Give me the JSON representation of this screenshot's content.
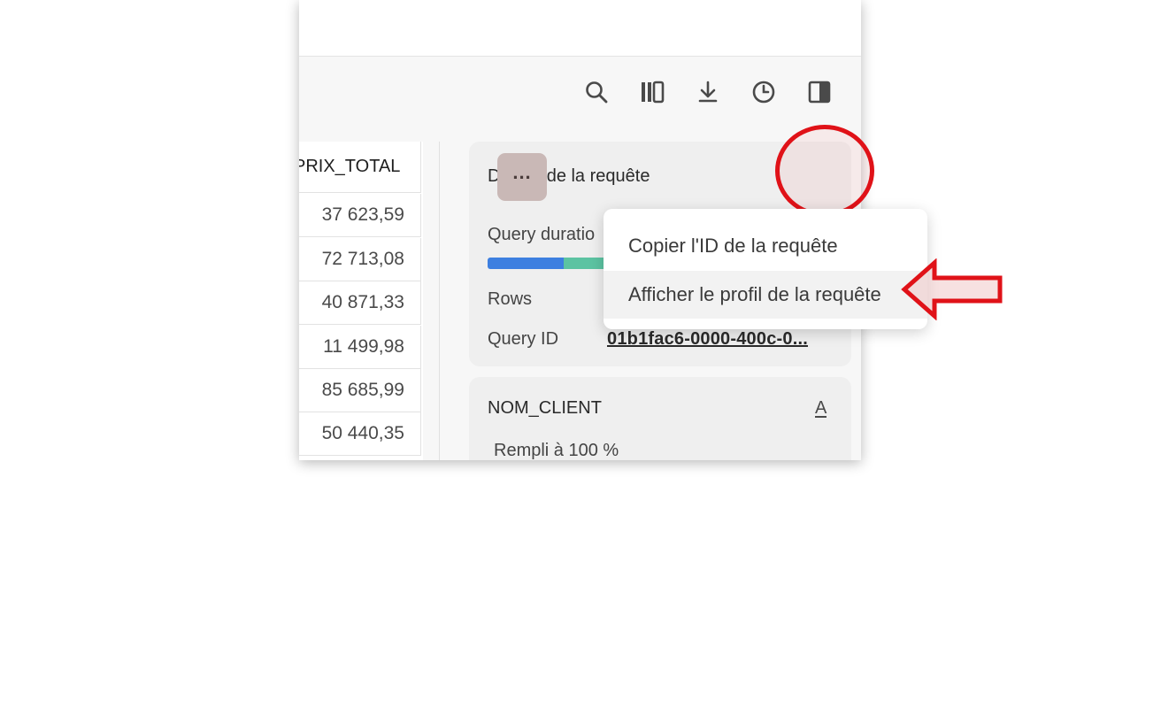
{
  "toolbar": {
    "icons": [
      "search-icon",
      "columns-icon",
      "download-icon",
      "history-icon",
      "split-panel-icon"
    ]
  },
  "table": {
    "column_header": "PRIX_TOTAL",
    "rows": [
      "37 623,59",
      "72 713,08",
      "40 871,33",
      "11 499,98",
      "85 685,99",
      "50 440,35"
    ]
  },
  "details": {
    "title": "Détails de la requête",
    "query_duration_label": "Query duratio",
    "rows_label": "Rows",
    "query_id_label": "Query ID",
    "query_id_value": "01b1fac6-0000-400c-0..."
  },
  "column_card": {
    "title": "NOM_CLIENT",
    "type_icon_text": "A",
    "fill_text": "Rempli à 100 %"
  },
  "more_button": {
    "label": "..."
  },
  "menu": {
    "items": [
      "Copier l'ID de la requête",
      "Afficher le profil de la requête"
    ]
  },
  "colors": {
    "annotation_red": "#e01218",
    "bar_blue": "#3d7fe0",
    "bar_green": "#5cc3a2"
  }
}
